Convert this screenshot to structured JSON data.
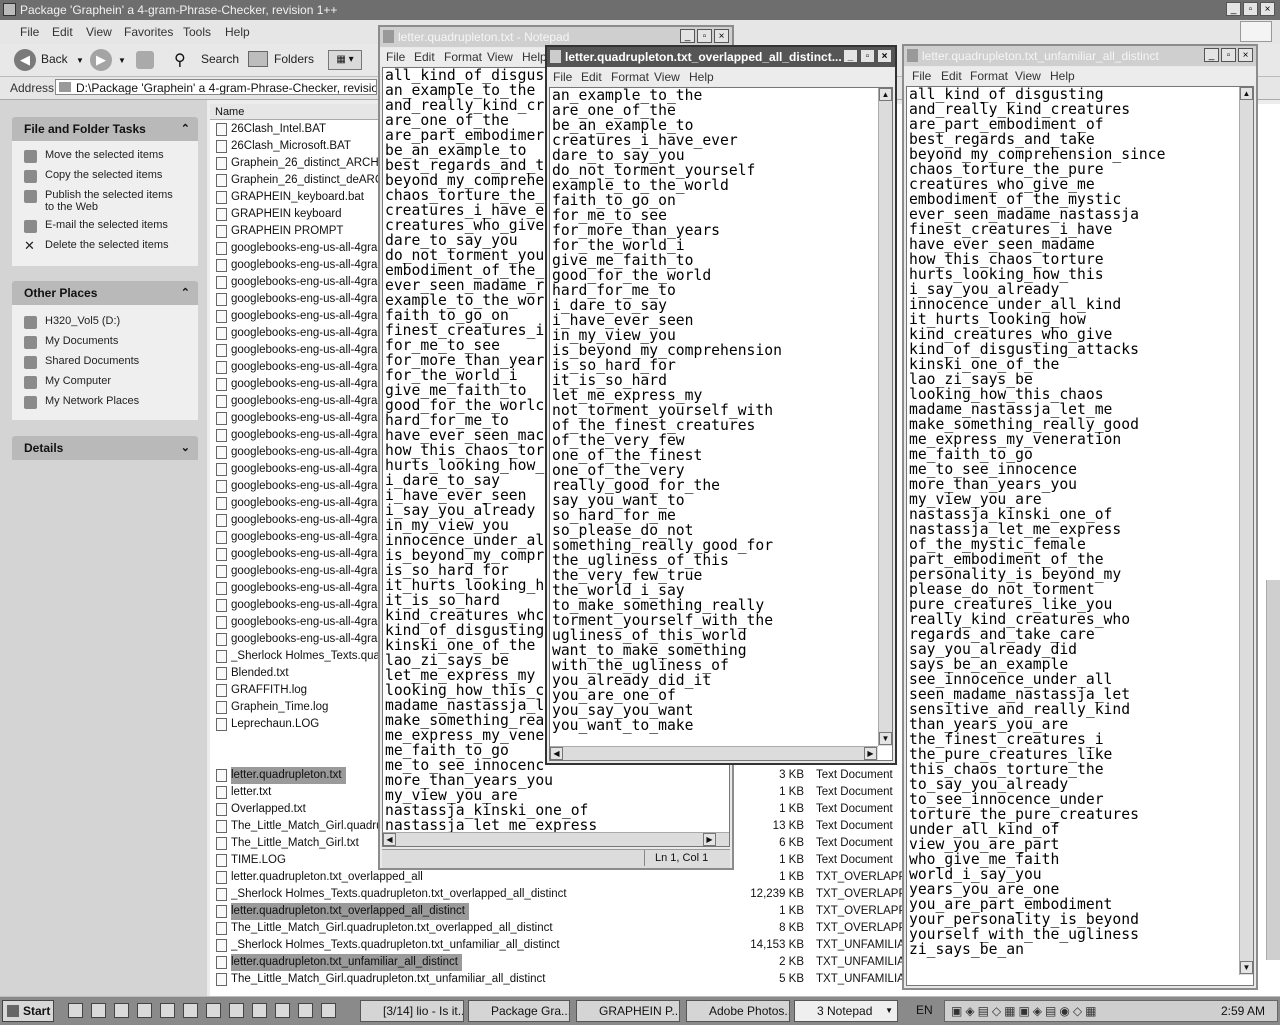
{
  "explorer": {
    "title": "Package 'Graphein' a 4-gram-Phrase-Checker, revision 1++",
    "menu": [
      "File",
      "Edit",
      "View",
      "Favorites",
      "Tools",
      "Help"
    ],
    "toolbar": {
      "back": "Back",
      "search": "Search",
      "folders": "Folders"
    },
    "address_label": "Address",
    "address_value": "D:\\Package 'Graphein' a 4-gram-Phrase-Checker, revision 1++",
    "tasks_header": "File and Folder Tasks",
    "tasks": [
      "Move the selected items",
      "Copy the selected items",
      "Publish the selected items to the Web",
      "E-mail the selected items",
      "Delete the selected items"
    ],
    "places_header": "Other Places",
    "places": [
      "H320_Vol5 (D:)",
      "My Documents",
      "Shared Documents",
      "My Computer",
      "My Network Places"
    ],
    "details_header": "Details",
    "column_name": "Name",
    "files_upper": [
      "26Clash_Intel.BAT",
      "26Clash_Microsoft.BAT",
      "Graphein_26_distinct_ARCHIV",
      "Graphein_26_distinct_deARCH",
      "GRAPHEIN_keyboard.bat",
      "GRAPHEIN keyboard",
      "GRAPHEIN PROMPT",
      "googlebooks-eng-us-all-4gram",
      "googlebooks-eng-us-all-4gram",
      "googlebooks-eng-us-all-4gram",
      "googlebooks-eng-us-all-4gram",
      "googlebooks-eng-us-all-4gram",
      "googlebooks-eng-us-all-4gram",
      "googlebooks-eng-us-all-4gram",
      "googlebooks-eng-us-all-4gram",
      "googlebooks-eng-us-all-4gram",
      "googlebooks-eng-us-all-4gram",
      "googlebooks-eng-us-all-4gram",
      "googlebooks-eng-us-all-4gram",
      "googlebooks-eng-us-all-4gram",
      "googlebooks-eng-us-all-4gram",
      "googlebooks-eng-us-all-4gram",
      "googlebooks-eng-us-all-4gram",
      "googlebooks-eng-us-all-4gram",
      "googlebooks-eng-us-all-4gram",
      "googlebooks-eng-us-all-4gram",
      "googlebooks-eng-us-all-4gram",
      "googlebooks-eng-us-all-4gram",
      "googlebooks-eng-us-all-4gram",
      "googlebooks-eng-us-all-4gram",
      "googlebooks-eng-us-all-4gram",
      "_Sherlock Holmes_Texts.quad",
      "Blended.txt",
      "GRAFFITH.log",
      "Graphein_Time.log",
      "Leprechaun.LOG"
    ],
    "files_lower": [
      {
        "name": "letter.quadrupleton.txt",
        "size": "3 KB",
        "type": "Text Document"
      },
      {
        "name": "letter.txt",
        "size": "1 KB",
        "type": "Text Document"
      },
      {
        "name": "Overlapped.txt",
        "size": "1 KB",
        "type": "Text Document"
      },
      {
        "name": "The_Little_Match_Girl.quadrup",
        "size": "13 KB",
        "type": "Text Document"
      },
      {
        "name": "The_Little_Match_Girl.txt",
        "size": "6 KB",
        "type": "Text Document"
      },
      {
        "name": "TIME.LOG",
        "size": "1 KB",
        "type": "Text Document"
      },
      {
        "name": "letter.quadrupleton.txt_overlapped_all",
        "size": "1 KB",
        "type": "TXT_OVERLAPPI"
      },
      {
        "name": "_Sherlock Holmes_Texts.quadrupleton.txt_overlapped_all_distinct",
        "size": "12,239 KB",
        "type": "TXT_OVERLAPPI"
      },
      {
        "name": "letter.quadrupleton.txt_overlapped_all_distinct",
        "size": "1 KB",
        "type": "TXT_OVERLAPPI"
      },
      {
        "name": "The_Little_Match_Girl.quadrupleton.txt_overlapped_all_distinct",
        "size": "8 KB",
        "type": "TXT_OVERLAPPI"
      },
      {
        "name": "_Sherlock Holmes_Texts.quadrupleton.txt_unfamiliar_all_distinct",
        "size": "14,153 KB",
        "type": "TXT_UNFAMILIAI"
      },
      {
        "name": "letter.quadrupleton.txt_unfamiliar_all_distinct",
        "size": "2 KB",
        "type": "TXT_UNFAMILIAI"
      },
      {
        "name": "The_Little_Match_Girl.quadrupleton.txt_unfamiliar_all_distinct",
        "size": "5 KB",
        "type": "TXT_UNFAMILIAI"
      }
    ]
  },
  "notepad_common": {
    "menu": [
      "File",
      "Edit",
      "Format",
      "View",
      "Help"
    ]
  },
  "notepad1": {
    "title": "letter.quadrupleton.txt - Notepad",
    "menu_help": "Help",
    "status": "Ln 1, Col 1",
    "lines": [
      "all_kind_of_disgus",
      "an_example_to_the",
      "and_really_kind_cr",
      "are_one_of_the",
      "are_part_embodimer",
      "be_an_example_to",
      "best_regards_and_t",
      "beyond_my_comprehe",
      "chaos_torture_the_",
      "creatures_i_have_e",
      "creatures_who_give",
      "dare_to_say_you",
      "do_not_torment_you",
      "embodiment_of_the_",
      "ever_seen_madame_r",
      "example_to_the_wor",
      "faith_to_go_on",
      "finest_creatures_i",
      "for_me_to_see",
      "for_more_than_year",
      "for_the_world_i",
      "give_me_faith_to",
      "good_for_the_worlc",
      "hard_for_me_to",
      "have_ever_seen_mac",
      "how_this_chaos_tor",
      "hurts_looking_how_",
      "i_dare_to_say",
      "i_have_ever_seen",
      "i_say_you_already",
      "in_my_view_you",
      "innocence_under_al",
      "is_beyond_my_compr",
      "is_so_hard_for",
      "it_hurts_looking_h",
      "it_is_so_hard",
      "kind_creatures_whc",
      "kind_of_disgusting",
      "kinski_one_of_the",
      "lao_zi_says_be",
      "let_me_express_my",
      "looking_how_this_c",
      "madame_nastassja_l",
      "make_something_rea",
      "me_express_my_vene",
      "me_faith_to_go",
      "me_to_see_innocenc",
      "more_than_years_you",
      "my_view_you_are",
      "nastassja_kinski_one_of",
      "nastassja_let_me_express"
    ]
  },
  "notepad2": {
    "title": "letter.quadrupleton.txt_overlapped_all_distinct...",
    "lines": [
      "an_example_to_the",
      "are_one_of_the",
      "be_an_example_to",
      "creatures_i_have_ever",
      "dare_to_say_you",
      "do_not_torment_yourself",
      "example_to_the_world",
      "faith_to_go_on",
      "for_me_to_see",
      "for_more_than_years",
      "for_the_world_i",
      "give_me_faith_to",
      "good_for_the_world",
      "hard_for_me_to",
      "i_dare_to_say",
      "i_have_ever_seen",
      "in_my_view_you",
      "is_beyond_my_comprehension",
      "is_so_hard_for",
      "it_is_so_hard",
      "let_me_express_my",
      "not_torment_yourself_with",
      "of_the_finest_creatures",
      "of_the_very_few",
      "one_of_the_finest",
      "one_of_the_very",
      "really_good_for_the",
      "say_you_want_to",
      "so_hard_for_me",
      "so_please_do_not",
      "something_really_good_for",
      "the_ugliness_of_this",
      "the_very_few_true",
      "the_world_i_say",
      "to_make_something_really",
      "torment_yourself_with_the",
      "ugliness_of_this_world",
      "want_to_make_something",
      "with_the_ugliness_of",
      "you_already_did_it",
      "you_are_one_of",
      "you_say_you_want",
      "you_want_to_make"
    ]
  },
  "notepad3": {
    "title": "letter.quadrupleton.txt_unfamiliar_all_distinct",
    "lines": [
      "all_kind_of_disgusting",
      "and_really_kind_creatures",
      "are_part_embodiment_of",
      "best_regards_and_take",
      "beyond_my_comprehension_since",
      "chaos_torture_the_pure",
      "creatures_who_give_me",
      "embodiment_of_the_mystic",
      "ever_seen_madame_nastassja",
      "finest_creatures_i_have",
      "have_ever_seen_madame",
      "how_this_chaos_torture",
      "hurts_looking_how_this",
      "i_say_you_already",
      "innocence_under_all_kind",
      "it_hurts_looking_how",
      "kind_creatures_who_give",
      "kind_of_disgusting_attacks",
      "kinski_one_of_the",
      "lao_zi_says_be",
      "looking_how_this_chaos",
      "madame_nastassja_let_me",
      "make_something_really_good",
      "me_express_my_veneration",
      "me_faith_to_go",
      "me_to_see_innocence",
      "more_than_years_you",
      "my_view_you_are",
      "nastassja_kinski_one_of",
      "nastassja_let_me_express",
      "of_the_mystic_female",
      "part_embodiment_of_the",
      "personality_is_beyond_my",
      "please_do_not_torment",
      "pure_creatures_like_you",
      "really_kind_creatures_who",
      "regards_and_take_care",
      "say_you_already_did",
      "says_be_an_example",
      "see_innocence_under_all",
      "seen_madame_nastassja_let",
      "sensitive_and_really_kind",
      "than_years_you_are",
      "the_finest_creatures_i",
      "the_pure_creatures_like",
      "this_chaos_torture_the",
      "to_say_you_already",
      "to_see_innocence_under",
      "torture_the_pure_creatures",
      "under_all_kind_of",
      "view_you_are_part",
      "who_give_me_faith",
      "world_i_say_you",
      "years_you_are_one",
      "you_are_part_embodiment",
      "your_personality_is_beyond",
      "yourself_with_the_ugliness",
      "zi_says_be_an"
    ]
  },
  "taskbar": {
    "start": "Start",
    "tasks": [
      "[3/14] lio - Is it...",
      "Package Gra...",
      "GRAPHEIN P...",
      "Adobe Photos...",
      "3 Notepad"
    ],
    "lang": "EN",
    "clock": "2:59 AM"
  }
}
